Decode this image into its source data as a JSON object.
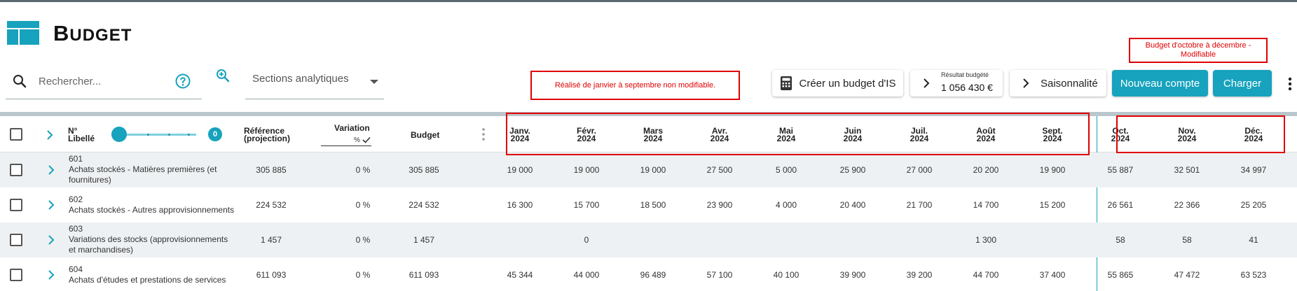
{
  "page": {
    "title_first": "B",
    "title_rest": "UDGET"
  },
  "search": {
    "placeholder": "Rechercher...",
    "value": ""
  },
  "sections": {
    "label": "Sections analytiques"
  },
  "annotations": {
    "realise": "Réalisé de janvier à septembre non modifiable.",
    "budget_line1": "Budget d'octobre à décembre -",
    "budget_line2": "Modifiable"
  },
  "buttons": {
    "budget_is": "Créer un budget d'IS",
    "resultat_label": "Résultat budgété",
    "resultat_value": "1 056 430 €",
    "saisonnalite": "Saisonnalité",
    "nouveau_compte": "Nouveau compte",
    "charger": "Charger"
  },
  "table": {
    "headers": {
      "numero": "N°",
      "libelle": "Libellé",
      "slider_value": "0",
      "reference_1": "Référence",
      "reference_2": "(projection)",
      "variation": "Variation",
      "variation_unit": "%",
      "budget": "Budget"
    },
    "months": [
      {
        "m": "Janv.",
        "y": "2024"
      },
      {
        "m": "Févr.",
        "y": "2024"
      },
      {
        "m": "Mars",
        "y": "2024"
      },
      {
        "m": "Avr.",
        "y": "2024"
      },
      {
        "m": "Mai",
        "y": "2024"
      },
      {
        "m": "Juin",
        "y": "2024"
      },
      {
        "m": "Juil.",
        "y": "2024"
      },
      {
        "m": "Août",
        "y": "2024"
      },
      {
        "m": "Sept.",
        "y": "2024"
      },
      {
        "m": "Oct.",
        "y": "2024"
      },
      {
        "m": "Nov.",
        "y": "2024"
      },
      {
        "m": "Déc.",
        "y": "2024"
      }
    ],
    "rows": [
      {
        "num": "601",
        "label": "Achats stockés - Matières premières (et fournitures)",
        "reference": "305 885",
        "variation": "0 %",
        "budget": "305 885",
        "values": [
          "19 000",
          "19 000",
          "19 000",
          "27 500",
          "5 000",
          "25 900",
          "27 000",
          "20 200",
          "19 900",
          "55 887",
          "32 501",
          "34 997"
        ]
      },
      {
        "num": "602",
        "label": "Achats stockés - Autres approvisionnements",
        "reference": "224 532",
        "variation": "0 %",
        "budget": "224 532",
        "values": [
          "16 300",
          "15 700",
          "18 500",
          "23 900",
          "4 000",
          "20 400",
          "21 700",
          "14 700",
          "15 200",
          "26 561",
          "22 366",
          "25 205"
        ]
      },
      {
        "num": "603",
        "label": "Variations des stocks (approvisionnements et marchandises)",
        "reference": "1 457",
        "variation": "0 %",
        "budget": "1 457",
        "values": [
          "",
          "0",
          "",
          "",
          "",
          "",
          "",
          "1 300",
          "",
          "58",
          "58",
          "41"
        ]
      },
      {
        "num": "604",
        "label": "Achats d'études et prestations de services",
        "reference": "611 093",
        "variation": "0 %",
        "budget": "611 093",
        "values": [
          "45 344",
          "44 000",
          "96 489",
          "57 100",
          "40 100",
          "39 900",
          "39 200",
          "44 700",
          "37 400",
          "55 865",
          "47 472",
          "63 523"
        ]
      }
    ]
  },
  "colors": {
    "accent": "#17a2bd",
    "annotation": "#e00000",
    "row_alt": "#eef1f3"
  }
}
